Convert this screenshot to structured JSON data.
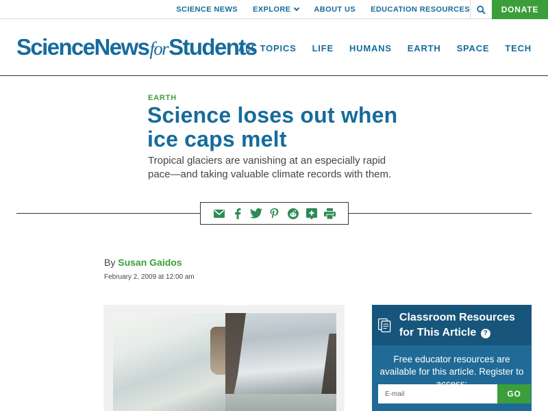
{
  "topbar": {
    "links": [
      "SCIENCE NEWS",
      "EXPLORE",
      "ABOUT US",
      "EDUCATION RESOURCES"
    ],
    "donate_label": "DONATE"
  },
  "header": {
    "logo": {
      "part1": "ScienceNews",
      "part2": "for",
      "part3": "Students"
    },
    "nav": [
      "ALL TOPICS",
      "LIFE",
      "HUMANS",
      "EARTH",
      "SPACE",
      "TECH"
    ]
  },
  "article": {
    "kicker": "EARTH",
    "headline": "Science loses out when ice caps melt",
    "dek": "Tropical glaciers are vanishing at an especially rapid pace—and taking valuable climate records with them.",
    "byline_prefix": "By",
    "author": "Susan Gaidos",
    "date": "February 2, 2009 at 12:00 am"
  },
  "share": {
    "icons": [
      "email-icon",
      "facebook-icon",
      "twitter-icon",
      "pinterest-icon",
      "reddit-icon",
      "google-classroom-icon",
      "print-icon"
    ]
  },
  "card": {
    "title": "Classroom Resources for This Article",
    "body": "Free educator resources are available for this article. Register to access:",
    "email_placeholder": "E-mail",
    "go_label": "GO"
  },
  "colors": {
    "brand_blue": "#176b9b",
    "brand_green": "#3b9e3b",
    "card_blue": "#1f6a96"
  }
}
